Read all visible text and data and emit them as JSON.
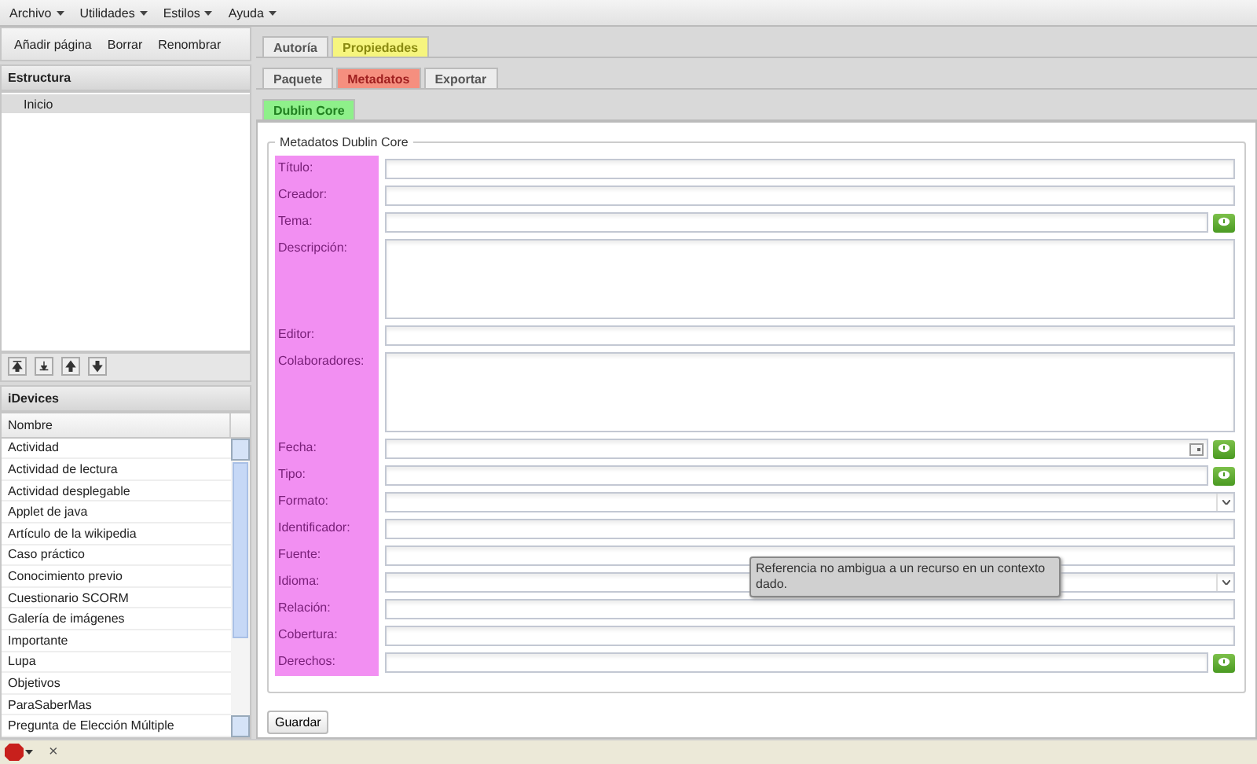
{
  "menu": [
    "Archivo",
    "Utilidades",
    "Estilos",
    "Ayuda"
  ],
  "structure_toolbar": [
    "Añadir página",
    "Borrar",
    "Renombrar"
  ],
  "structure": {
    "title": "Estructura",
    "items": [
      {
        "label": "Inicio",
        "selected": true
      }
    ]
  },
  "idevices": {
    "title": "iDevices",
    "column": "Nombre",
    "items": [
      "Actividad",
      "Actividad de lectura",
      "Actividad desplegable",
      "Applet de java",
      "Artículo de la wikipedia",
      "Caso práctico",
      "Conocimiento previo",
      "Cuestionario SCORM",
      "Galería de imágenes",
      "Importante",
      "Lupa",
      "Objetivos",
      "ParaSaberMas",
      "Pregunta de Elección Múltiple"
    ]
  },
  "tab_rows": [
    [
      {
        "label": "Autoría",
        "selected": false
      },
      {
        "label": "Propiedades",
        "selected": true
      }
    ],
    [
      {
        "label": "Paquete",
        "selected": false
      },
      {
        "label": "Metadatos",
        "selected": true
      },
      {
        "label": "Exportar",
        "selected": false
      }
    ],
    [
      {
        "label": "Dublin Core",
        "selected": true
      }
    ]
  ],
  "fieldset": {
    "legend": "Metadatos Dublin Core",
    "fields": [
      {
        "label": "Título:",
        "kind": "text",
        "info": false
      },
      {
        "label": "Creador:",
        "kind": "text",
        "info": false
      },
      {
        "label": "Tema:",
        "kind": "text",
        "info": true
      },
      {
        "label": "Descripción:",
        "kind": "textarea",
        "info": false
      },
      {
        "label": "Editor:",
        "kind": "text",
        "info": false
      },
      {
        "label": "Colaboradores:",
        "kind": "textarea",
        "info": false
      },
      {
        "label": "Fecha:",
        "kind": "date",
        "info": true
      },
      {
        "label": "Tipo:",
        "kind": "text",
        "info": true
      },
      {
        "label": "Formato:",
        "kind": "select",
        "info": false
      },
      {
        "label": "Identificador:",
        "kind": "text",
        "info": false
      },
      {
        "label": "Fuente:",
        "kind": "text",
        "info": false
      },
      {
        "label": "Idioma:",
        "kind": "select",
        "info": false
      },
      {
        "label": "Relación:",
        "kind": "text",
        "info": false
      },
      {
        "label": "Cobertura:",
        "kind": "text",
        "info": false
      },
      {
        "label": "Derechos:",
        "kind": "text",
        "info": true
      }
    ]
  },
  "tooltip": "Referencia no ambigua a un recurso en un contexto dado.",
  "save_button": "Guardar",
  "status_bar": {
    "close": "×"
  }
}
